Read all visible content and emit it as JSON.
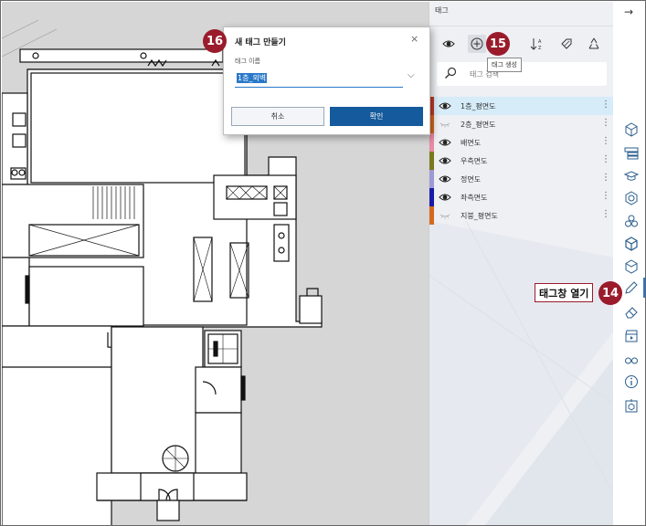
{
  "dialog": {
    "title": "새 태그 만들기",
    "close": "×",
    "field_label": "태그 이름",
    "field_value": "1층_외벽",
    "caret": "⌵",
    "cancel_label": "취소",
    "ok_label": "확인"
  },
  "panel": {
    "title": "태그",
    "tooltip": "태그 생성",
    "search_placeholder": "태그 검색",
    "toolbar": [
      {
        "name": "eye-icon",
        "glyph": "👁"
      },
      {
        "name": "add-tag-icon",
        "glyph": "⊕"
      },
      {
        "name": "sort-icon",
        "glyph": "↓ᴬᴢ"
      },
      {
        "name": "tag-icon",
        "glyph": "◈"
      },
      {
        "name": "recycle-icon",
        "glyph": "♻"
      }
    ],
    "tags": [
      {
        "label": "1층_평면도",
        "color": "#c0392b",
        "visible": true,
        "selected": true
      },
      {
        "label": "2층_평면도",
        "color": "#d46a1e",
        "visible": false,
        "selected": false
      },
      {
        "label": "배면도",
        "color": "#e98aa6",
        "visible": true,
        "selected": false
      },
      {
        "label": "우측면도",
        "color": "#7a7a1c",
        "visible": true,
        "selected": false
      },
      {
        "label": "정면도",
        "color": "#9c9ad6",
        "visible": true,
        "selected": false
      },
      {
        "label": "좌측면도",
        "color": "#1a1aa8",
        "visible": true,
        "selected": false
      },
      {
        "label": "지붕_평면도",
        "color": "#d46a1e",
        "visible": false,
        "selected": false
      }
    ],
    "more": "⋮"
  },
  "rail": {
    "collapse": "→",
    "icons": [
      "cube-outline-icon",
      "layers-list-icon",
      "graduation-cap-icon",
      "hexagon-nut-icon",
      "cubes-stack-icon",
      "cube-3d-icon",
      "cube-open-icon",
      "tag-pen-icon",
      "eraser-icon",
      "video-clapper-icon",
      "glasses-icon",
      "info-icon",
      "cube-export-icon"
    ]
  },
  "callouts": {
    "step14": "14",
    "step15": "15",
    "step16": "16",
    "step14_label": "태그창 열기"
  },
  "colors": {
    "accent": "#2a79c8",
    "primary_button": "#145a9c",
    "badge": "#9a1b2b",
    "canvas": "#d6d6d6"
  }
}
